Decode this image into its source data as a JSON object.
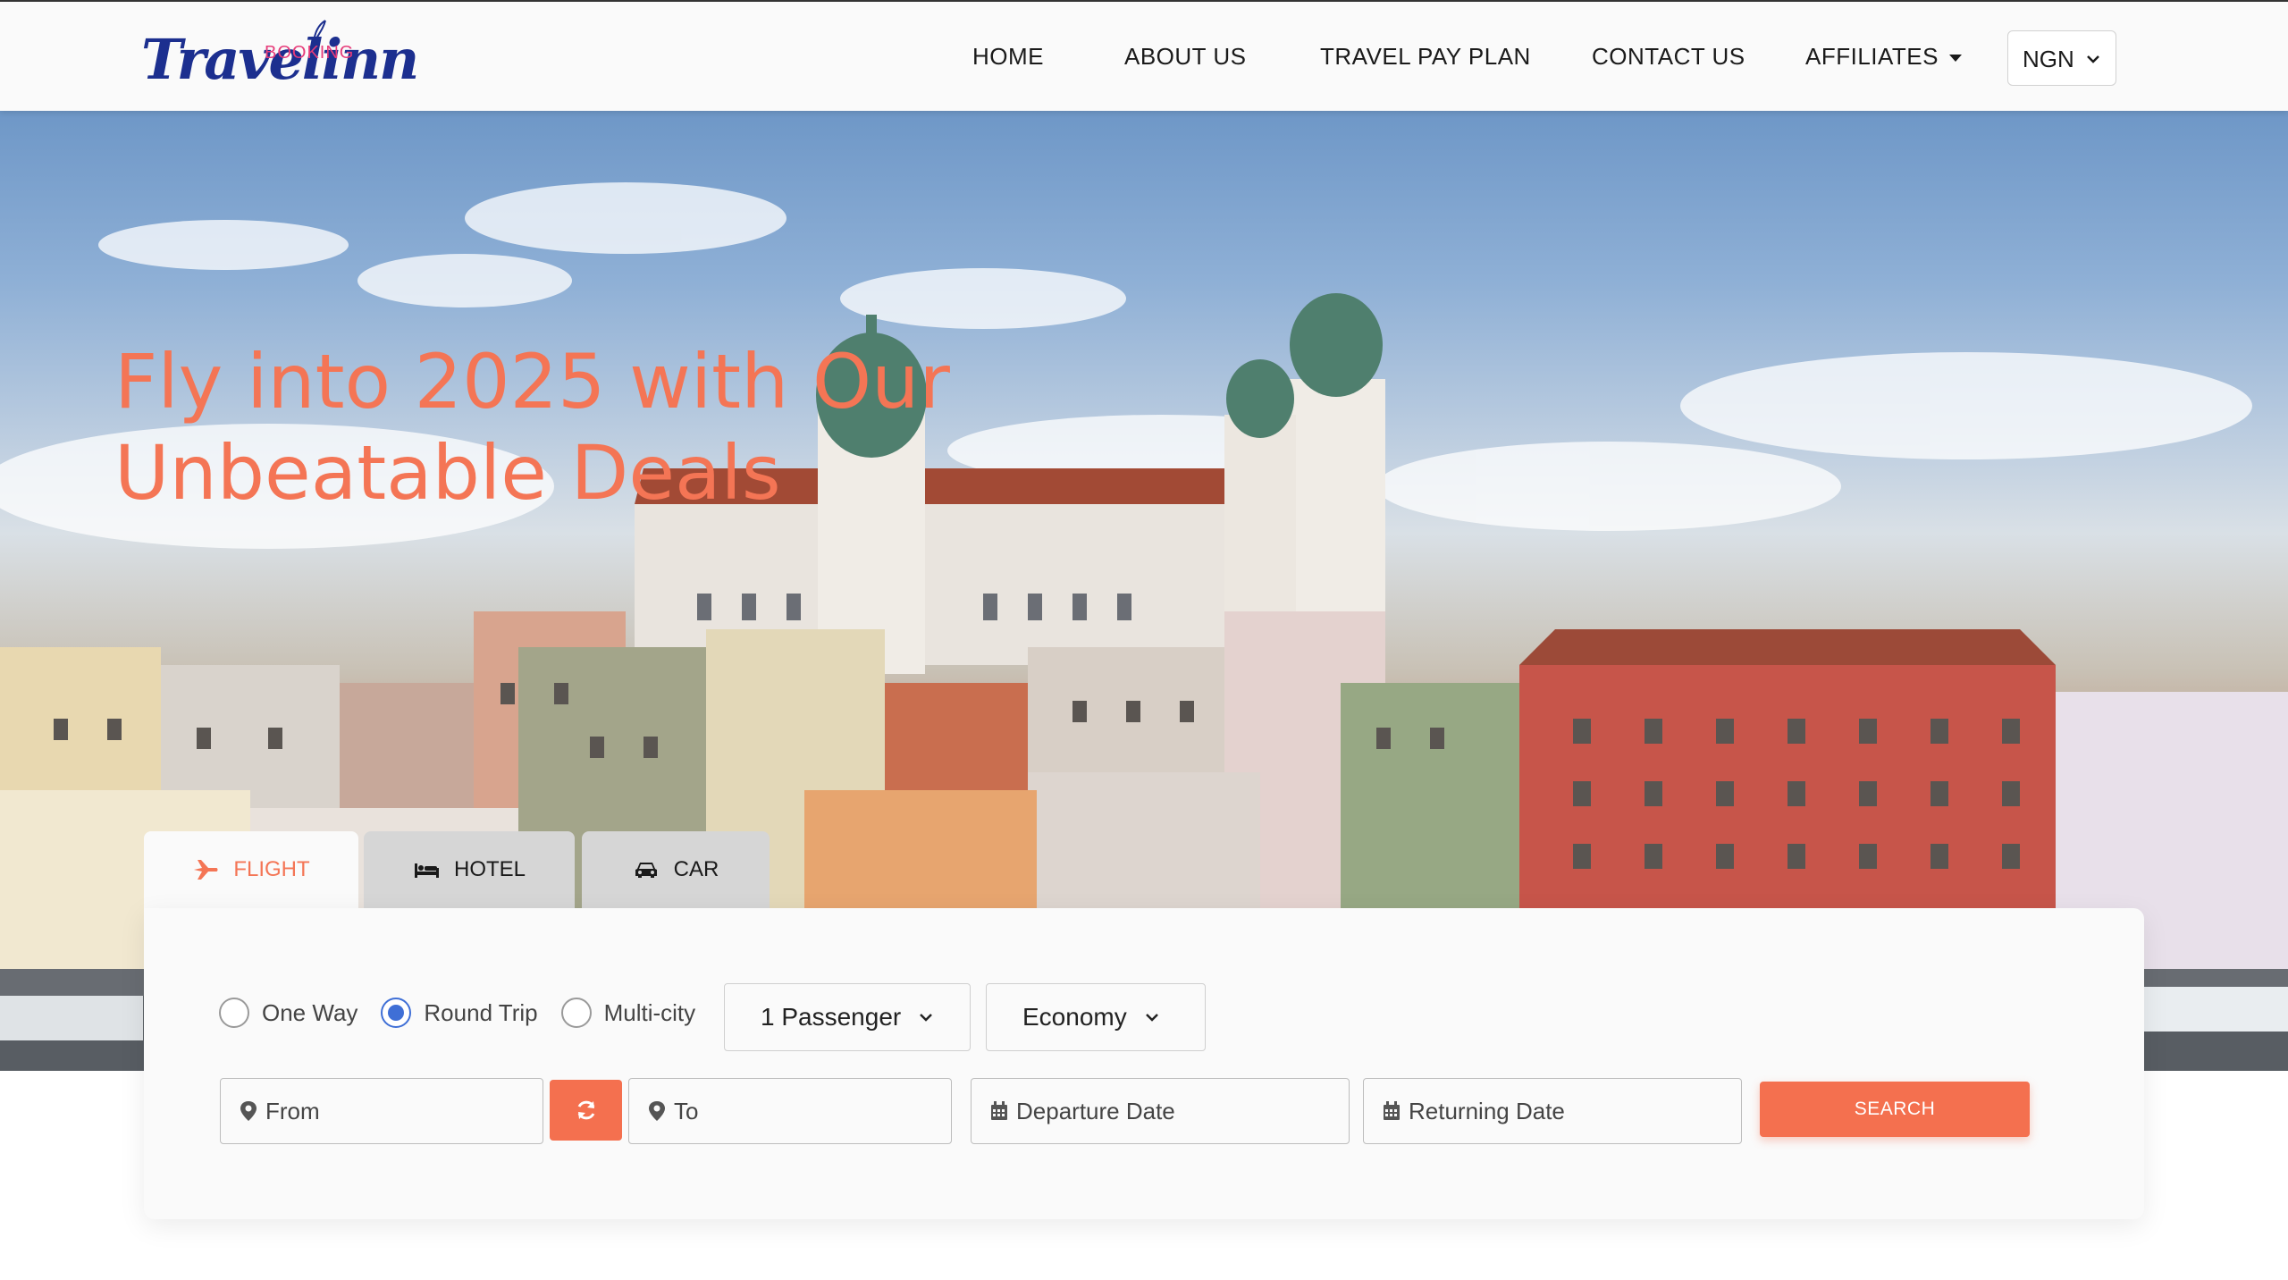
{
  "brand": {
    "logo_script": "Travelinn",
    "logo_small": "BOOKING"
  },
  "nav": {
    "items": [
      "HOME",
      "ABOUT US",
      "TRAVEL PAY PLAN",
      "CONTACT US",
      "AFFILIATES"
    ],
    "currency": "NGN"
  },
  "hero": {
    "title_line1": "Fly into 2025 with Our",
    "title_line2": "Unbeatable Deals"
  },
  "tabs": [
    {
      "label": "FLIGHT",
      "icon": "plane-icon",
      "active": true
    },
    {
      "label": "HOTEL",
      "icon": "bed-icon",
      "active": false
    },
    {
      "label": "CAR",
      "icon": "car-icon",
      "active": false
    }
  ],
  "search": {
    "trip_types": [
      {
        "label": "One Way",
        "selected": false
      },
      {
        "label": "Round Trip",
        "selected": true
      },
      {
        "label": "Multi-city",
        "selected": false
      }
    ],
    "passengers": "1 Passenger",
    "cabin_class": "Economy",
    "from_placeholder": "From",
    "to_placeholder": "To",
    "departure_placeholder": "Departure Date",
    "return_placeholder": "Returning Date",
    "search_label": "SEARCH"
  },
  "colors": {
    "accent": "#f4704f",
    "brand_blue": "#1c2f8f",
    "radio_selected": "#3f6fd6"
  }
}
